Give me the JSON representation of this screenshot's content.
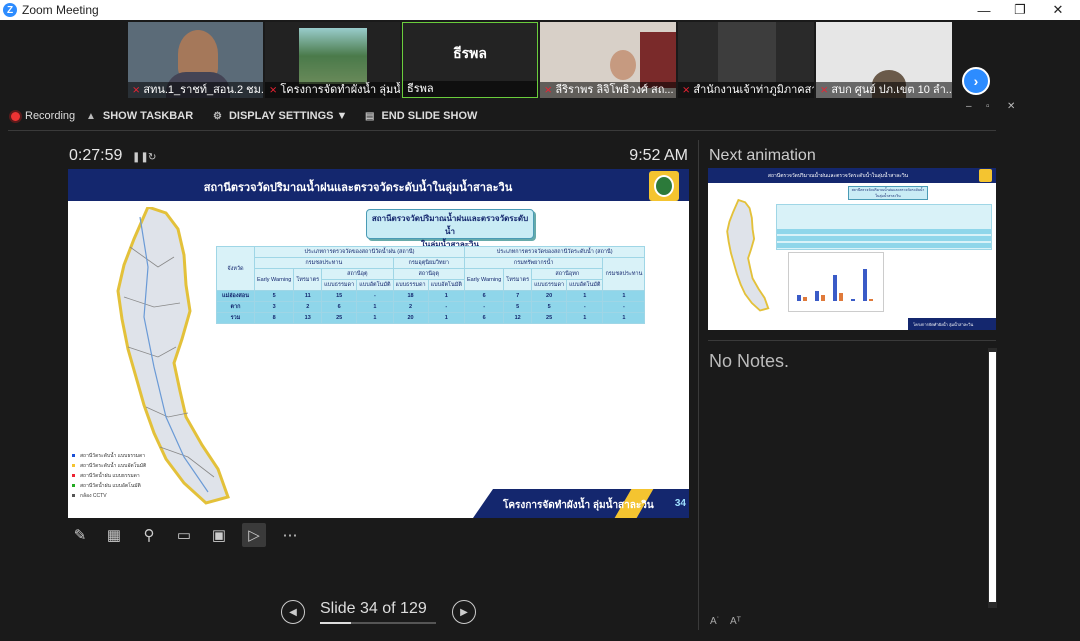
{
  "window": {
    "title": "Zoom Meeting",
    "logo": "Z"
  },
  "participants": [
    {
      "name": "สทน.1_ราชท์_สอน.2 ชม.",
      "type": "video",
      "muted": true
    },
    {
      "name": "โครงการจัดทำผังน้ำ ลุ่มน้ำ...",
      "type": "video",
      "muted": true
    },
    {
      "name": "ธีรพล",
      "display": "ธีรพล",
      "type": "avatar",
      "muted": false
    },
    {
      "name": "ลีริราพร ลิจิโพธิวงศ์ สถ...",
      "type": "video",
      "muted": true
    },
    {
      "name": "สำนักงานเจ้าท่าภูมิภาคสา...",
      "type": "video",
      "muted": true
    },
    {
      "name": "สบก ศูนย์ ปภ.เขต 10 ลำ...",
      "type": "video",
      "muted": true
    }
  ],
  "toolbar": {
    "recording": "Recording",
    "show_taskbar": "SHOW TASKBAR",
    "display_settings": "DISPLAY SETTINGS ▼",
    "end_slide_show": "END SLIDE SHOW"
  },
  "presenter": {
    "timer": "0:27:59",
    "clock": "9:52 AM",
    "slide_label": "Slide 34 of 129",
    "current_slide": 34,
    "total_slides": 129,
    "next_label": "Next animation",
    "notes": "No Notes."
  },
  "slide": {
    "title": "สถานีตรวจวัดปริมาณน้ำฝนและตรวจวัดระดับน้ำในลุ่มน้ำสาละวิน",
    "box_title_1": "สถานีตรวจวัดปริมาณน้ำฝนและตรวจวัดระดับน้ำ",
    "box_title_2": "ในลุ่มน้ำสาละวิน",
    "footer": "โครงการจัดทำผังน้ำ ลุ่มน้ำสาละวิน",
    "page": "34",
    "table": {
      "col_province": "จังหวัด",
      "group_rain": "ประเภทการตรวจวัดของสถานีวัดน้ำฝน (สถานี)",
      "group_level": "ประเภทการตรวจวัดของสถานีวัดระดับน้ำ (สถานี)",
      "sub_rid": "กรมชลประทาน",
      "sub_tmd": "กรมอุตุนิยมวิทยา",
      "sub_hii": "กรมทรัพยากรน้ำ",
      "sub_dwr": "กรมอุทกศาสตร์",
      "sub_rid2": "กรมชลประทาน",
      "ew": "Early Warning",
      "tele": "โทรมาตร",
      "tele2": "โทรมาตร",
      "station": "สถานีอุตุ",
      "station2": "สถานีอุทก",
      "manual": "แบบธรรมดา",
      "auto": "แบบอัตโนมัติ",
      "rows": [
        {
          "name": "แม่ฮ่องสอน",
          "v": [
            "5",
            "11",
            "15",
            "-",
            "18",
            "1",
            "6",
            "7",
            "20",
            "1",
            "1"
          ]
        },
        {
          "name": "ตาก",
          "v": [
            "3",
            "2",
            "6",
            "1",
            "2",
            "-",
            "-",
            "5",
            "5",
            "-",
            "-"
          ]
        },
        {
          "name": "รวม",
          "v": [
            "8",
            "13",
            "25",
            "1",
            "20",
            "1",
            "6",
            "12",
            "25",
            "1",
            "1"
          ]
        }
      ]
    },
    "legend": [
      {
        "label": "สถานีวัดระดับน้ำ แบบธรรมดา",
        "color": "#1a4fd6"
      },
      {
        "label": "สถานีวัดระดับน้ำ แบบอัตโนมัติ",
        "color": "#f4c430"
      },
      {
        "label": "สถานีวัดน้ำฝน แบบธรรมดา",
        "color": "#e23"
      },
      {
        "label": "สถานีวัดน้ำฝน แบบอัตโนมัติ",
        "color": "#2a2"
      },
      {
        "label": "กล้อง CCTV",
        "color": "#555"
      }
    ]
  },
  "colors": {
    "brand_blue": "#2d8cff",
    "slide_navy": "#14276e",
    "slide_gold": "#f4c430",
    "record_red": "#e33"
  },
  "icons": {
    "pen": "pen-icon",
    "slides": "slide-grid-icon",
    "zoom": "magnifier-icon",
    "screen_off": "screen-off-icon",
    "subtitles": "subtitles-icon",
    "camera": "camera-icon",
    "more": "more-icon"
  }
}
